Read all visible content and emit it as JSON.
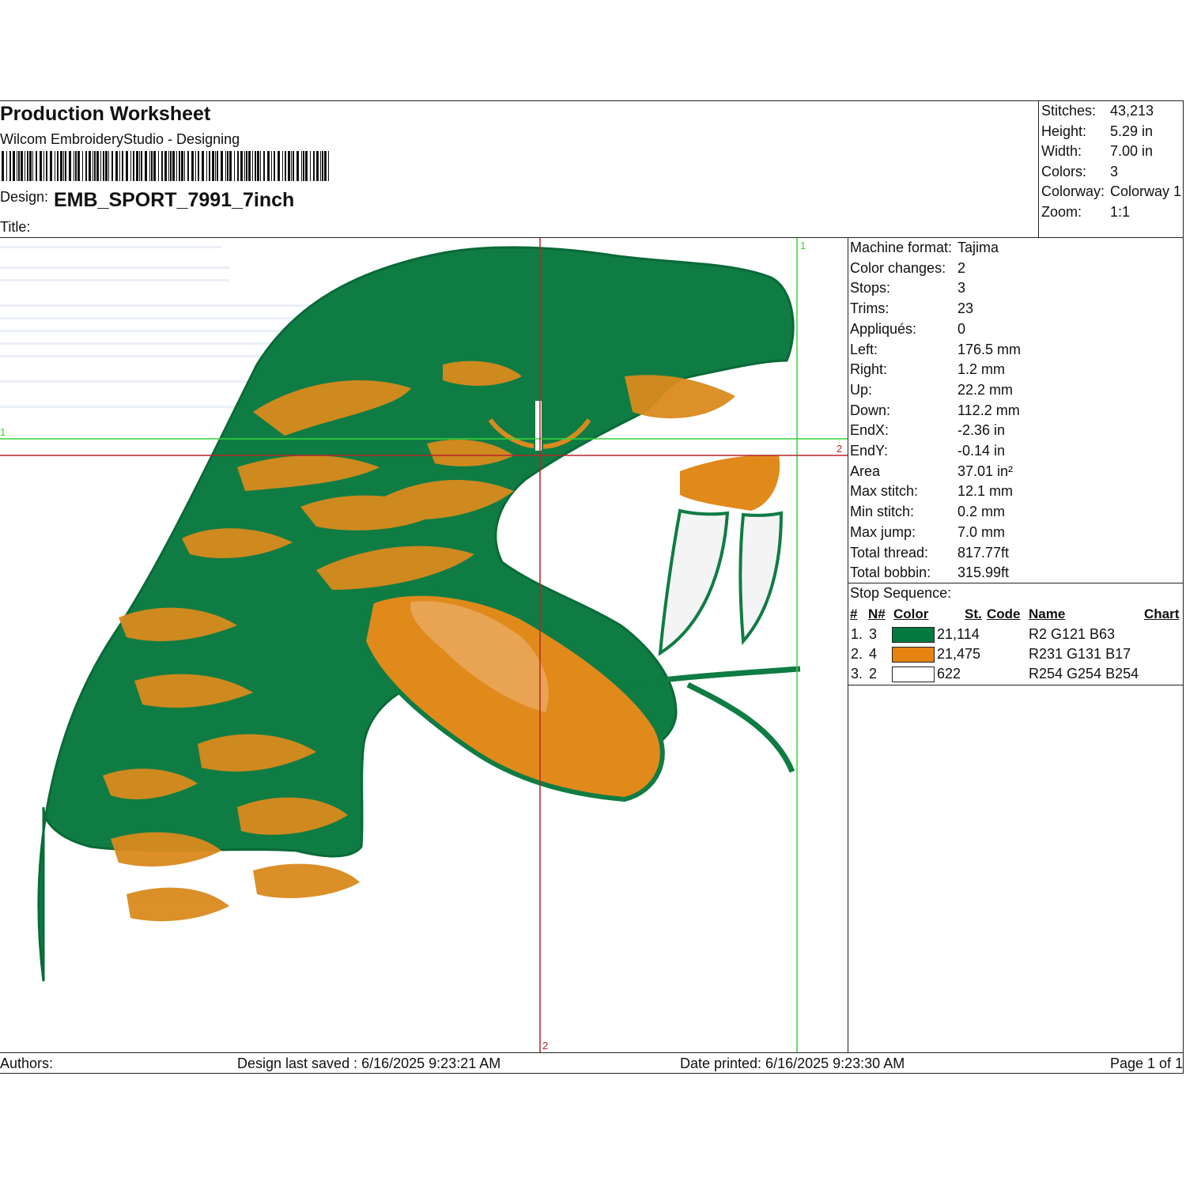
{
  "header": {
    "title": "Production Worksheet",
    "software": "Wilcom EmbroideryStudio - Designing",
    "design_label": "Design:",
    "design_name": "EMB_SPORT_7991_7inch",
    "title_label": "Title:"
  },
  "summary": [
    {
      "label": "Stitches:",
      "value": "43,213"
    },
    {
      "label": "Height:",
      "value": "5.29 in"
    },
    {
      "label": "Width:",
      "value": "7.00 in"
    },
    {
      "label": "Colors:",
      "value": "3"
    },
    {
      "label": "Colorway:",
      "value": "Colorway 1"
    },
    {
      "label": "Zoom:",
      "value": "1:1"
    }
  ],
  "details": [
    {
      "label": "Machine format:",
      "value": "Tajima"
    },
    {
      "label": "Color changes:",
      "value": "2"
    },
    {
      "label": "Stops:",
      "value": "3"
    },
    {
      "label": "Trims:",
      "value": "23"
    },
    {
      "label": "Appliqués:",
      "value": "0"
    },
    {
      "label": "Left:",
      "value": "176.5 mm"
    },
    {
      "label": "Right:",
      "value": "1.2 mm"
    },
    {
      "label": "Up:",
      "value": "22.2 mm"
    },
    {
      "label": "Down:",
      "value": "112.2 mm"
    },
    {
      "label": "EndX:",
      "value": "-2.36 in"
    },
    {
      "label": "EndY:",
      "value": "-0.14 in"
    },
    {
      "label": "Area",
      "value": " 37.01 in²"
    },
    {
      "label": "Max stitch:",
      "value": "12.1 mm"
    },
    {
      "label": "Min stitch:",
      "value": "0.2 mm"
    },
    {
      "label": "Max jump:",
      "value": "7.0 mm"
    },
    {
      "label": "Total thread:",
      "value": "817.77ft"
    },
    {
      "label": "Total bobbin:",
      "value": "315.99ft"
    }
  ],
  "stop_sequence": {
    "title": "Stop Sequence:",
    "columns": {
      "num": "#",
      "needle": "N#",
      "color": "Color",
      "stitches": "St.",
      "code": "Code",
      "name": "Name",
      "chart": "Chart"
    },
    "rows": [
      {
        "num": "1.",
        "needle": "3",
        "color": "#027940",
        "stitches": "21,114",
        "name": "R2 G121 B63"
      },
      {
        "num": "2.",
        "needle": "4",
        "color": "#E78311",
        "stitches": "21,475",
        "name": "R231 G131 B17"
      },
      {
        "num": "3.",
        "needle": "2",
        "color": "#FEFEFE",
        "stitches": "622",
        "name": "R254 G254 B254"
      }
    ]
  },
  "canvas": {
    "guide_labels": {
      "green_v": "1",
      "green_h": "1",
      "red_h": "2",
      "red_v": "2"
    }
  },
  "footer": {
    "authors": "Authors:",
    "saved": "Design last saved : 6/16/2025 9:23:21 AM",
    "printed": "Date printed: 6/16/2025 9:23:30 AM",
    "page": "Page 1 of 1"
  },
  "colors": {
    "green": "#027940",
    "orange": "#E78311",
    "white": "#FEFEFE",
    "guide_green": "#39d43a",
    "guide_red": "#b3262a"
  }
}
